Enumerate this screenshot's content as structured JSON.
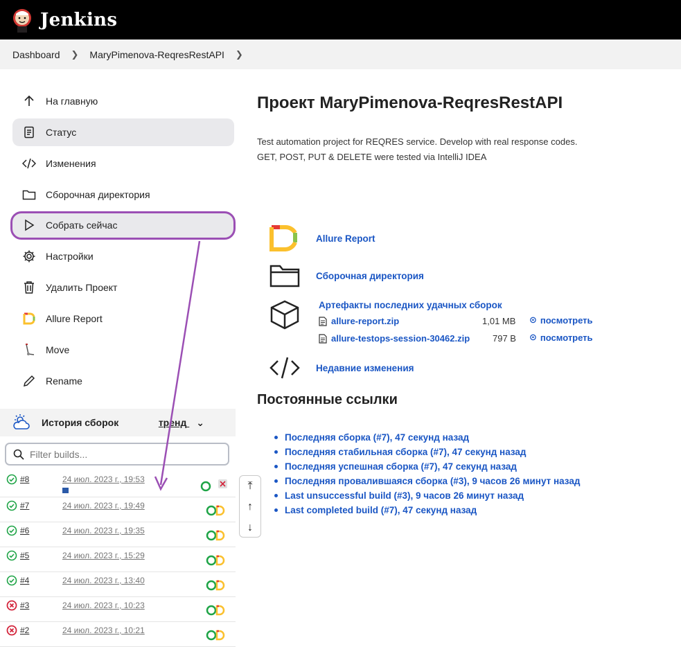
{
  "header": {
    "brand": "Jenkins"
  },
  "breadcrumbs": [
    "Dashboard",
    "MaryPimenova-ReqresRestAPI"
  ],
  "sidebar": {
    "items": [
      {
        "label": "На главную",
        "icon": "arrow-up-icon"
      },
      {
        "label": "Статус",
        "icon": "document-icon"
      },
      {
        "label": "Изменения",
        "icon": "code-icon"
      },
      {
        "label": "Сборочная директория",
        "icon": "folder-icon"
      },
      {
        "label": "Собрать сейчас",
        "icon": "play-icon"
      },
      {
        "label": "Настройки",
        "icon": "gear-icon"
      },
      {
        "label": "Удалить Проект",
        "icon": "trash-icon"
      },
      {
        "label": "Allure Report",
        "icon": "allure-icon"
      },
      {
        "label": "Move",
        "icon": "move-icon"
      },
      {
        "label": "Rename",
        "icon": "pencil-icon"
      }
    ]
  },
  "history": {
    "title": "История сборок",
    "trend": "тренд",
    "filter_placeholder": "Filter builds...",
    "builds": [
      {
        "num": "#8",
        "date": "24 июл. 2023 г., 19:53",
        "status": "running"
      },
      {
        "num": "#7",
        "date": "24 июл. 2023 г., 19:49",
        "status": "success"
      },
      {
        "num": "#6",
        "date": "24 июл. 2023 г., 19:35",
        "status": "success"
      },
      {
        "num": "#5",
        "date": "24 июл. 2023 г., 15:29",
        "status": "success"
      },
      {
        "num": "#4",
        "date": "24 июл. 2023 г., 13:40",
        "status": "success"
      },
      {
        "num": "#3",
        "date": "24 июл. 2023 г., 10:23",
        "status": "failed"
      },
      {
        "num": "#2",
        "date": "24 июл. 2023 г., 10:21",
        "status": "failed"
      }
    ]
  },
  "main": {
    "title": "Проект MaryPimenova-ReqresRestAPI",
    "description_line1": "Test automation project for REQRES service. Develop with real response codes.",
    "description_line2": "GET, POST, PUT & DELETE were tested via IntelliJ IDEA",
    "allure_link": "Allure Report",
    "workspace_link": "Сборочная директория",
    "artifacts_title": "Артефакты последних удачных сборок",
    "artifacts": [
      {
        "name": "allure-report.zip",
        "size": "1,01 MB",
        "view": "посмотреть"
      },
      {
        "name": "allure-testops-session-30462.zip",
        "size": "797 B",
        "view": "посмотреть"
      }
    ],
    "changes_link": "Недавние изменения",
    "permalinks_title": "Постоянные ссылки",
    "permalinks": [
      "Последняя сборка (#7), 47 секунд назад",
      "Последняя стабильная сборка (#7), 47 секунд назад",
      "Последняя успешная сборка (#7), 47 секунд назад",
      "Последняя провалившаяся сборка (#3), 9 часов 26 минут назад",
      "Last unsuccessful build (#3), 9 часов 26 минут назад",
      "Last completed build (#7), 47 секунд назад"
    ]
  },
  "colors": {
    "link": "#1a56c4",
    "annotation": "#9b4fb4",
    "success": "#1ea446",
    "failed": "#d3243b"
  }
}
